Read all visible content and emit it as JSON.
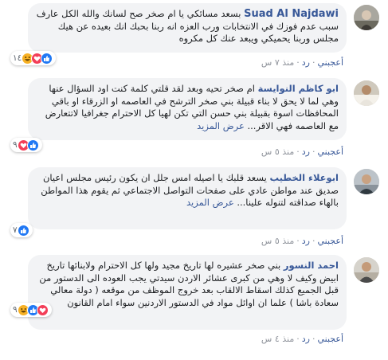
{
  "comments": [
    {
      "author": "Suad Al Najdawi",
      "text": "بسعد مسائكي يا ام صخر صح لسانك والله الكل عارف سبب عدم فوزك في الانتخابات ورب العزه انه ربنا بحبك انك بعيده عن هيك مجلس وربنا يحميكي ويبعد عنك كل مكروه",
      "more": "",
      "reaction_count": "١٤",
      "actions": {
        "like": "أعجبني",
        "reply": "رد",
        "time": "منذ ٧ س"
      }
    },
    {
      "author": "ابو كاظم النوايسة",
      "text": "ام صخر تحيه وبعد لقد قلتي كلمة كنت اود السؤال عنها وهي لما لا يحق لا بناء قبيلة بني صخر الترشح في العاصمه او الزرقاء او باقي المحافظات اسوة بقبيلة بني حسن التي تكن لهيا كل الاحترام جغرافيا لاتتعارض مع العاصمه فهي الاقر...",
      "more": "عرض المزيد",
      "reaction_count": "٩",
      "actions": {
        "like": "أعجبني",
        "reply": "رد",
        "time": "منذ ٥ س"
      }
    },
    {
      "author": "ابوعلاء الخطيب",
      "text": "يسعد قلبك يا اصيله امس جلل ان يكون رئيس مجلس اعيان صديق عند مواطن عادي على صفحات التواصل الاجتماعي ثم يقوم هذا المواطن بالهاء صداقته لتنوله علينا...",
      "more": "عرض المزيد",
      "reaction_count": "٧",
      "actions": {
        "like": "أعجبني",
        "reply": "رد",
        "time": "منذ ٥ س"
      }
    },
    {
      "author": "احمد النسور",
      "text": "بني صخر عشيره لها تاريخ مجيد ولها كل الاحترام ولابنائها تاريخ ابيض وكيف لا وهي من كبرى عشائر الاردن سيدتي يجب العوده الى الدستور من قبل الجميع كذلك اسقاط الالقاب بعد خروج الموظف من موقعه ( دولة معالي سعادة باشا ) علما ان اوائل مواد في الدستور الاردنين سواء امام القانون",
      "more": "",
      "reaction_count": "٩",
      "actions": {
        "like": "أعجبني",
        "reply": "رد",
        "time": "منذ ٤ س"
      }
    }
  ],
  "colors": {
    "link": "#385898",
    "bubble": "#f2f3f5",
    "meta": "#90949c",
    "like_blue": "#2078f4",
    "love_red": "#f33e58",
    "haha_yellow": "#f7b125"
  },
  "icons": [
    "like-icon",
    "love-icon",
    "haha-icon"
  ]
}
